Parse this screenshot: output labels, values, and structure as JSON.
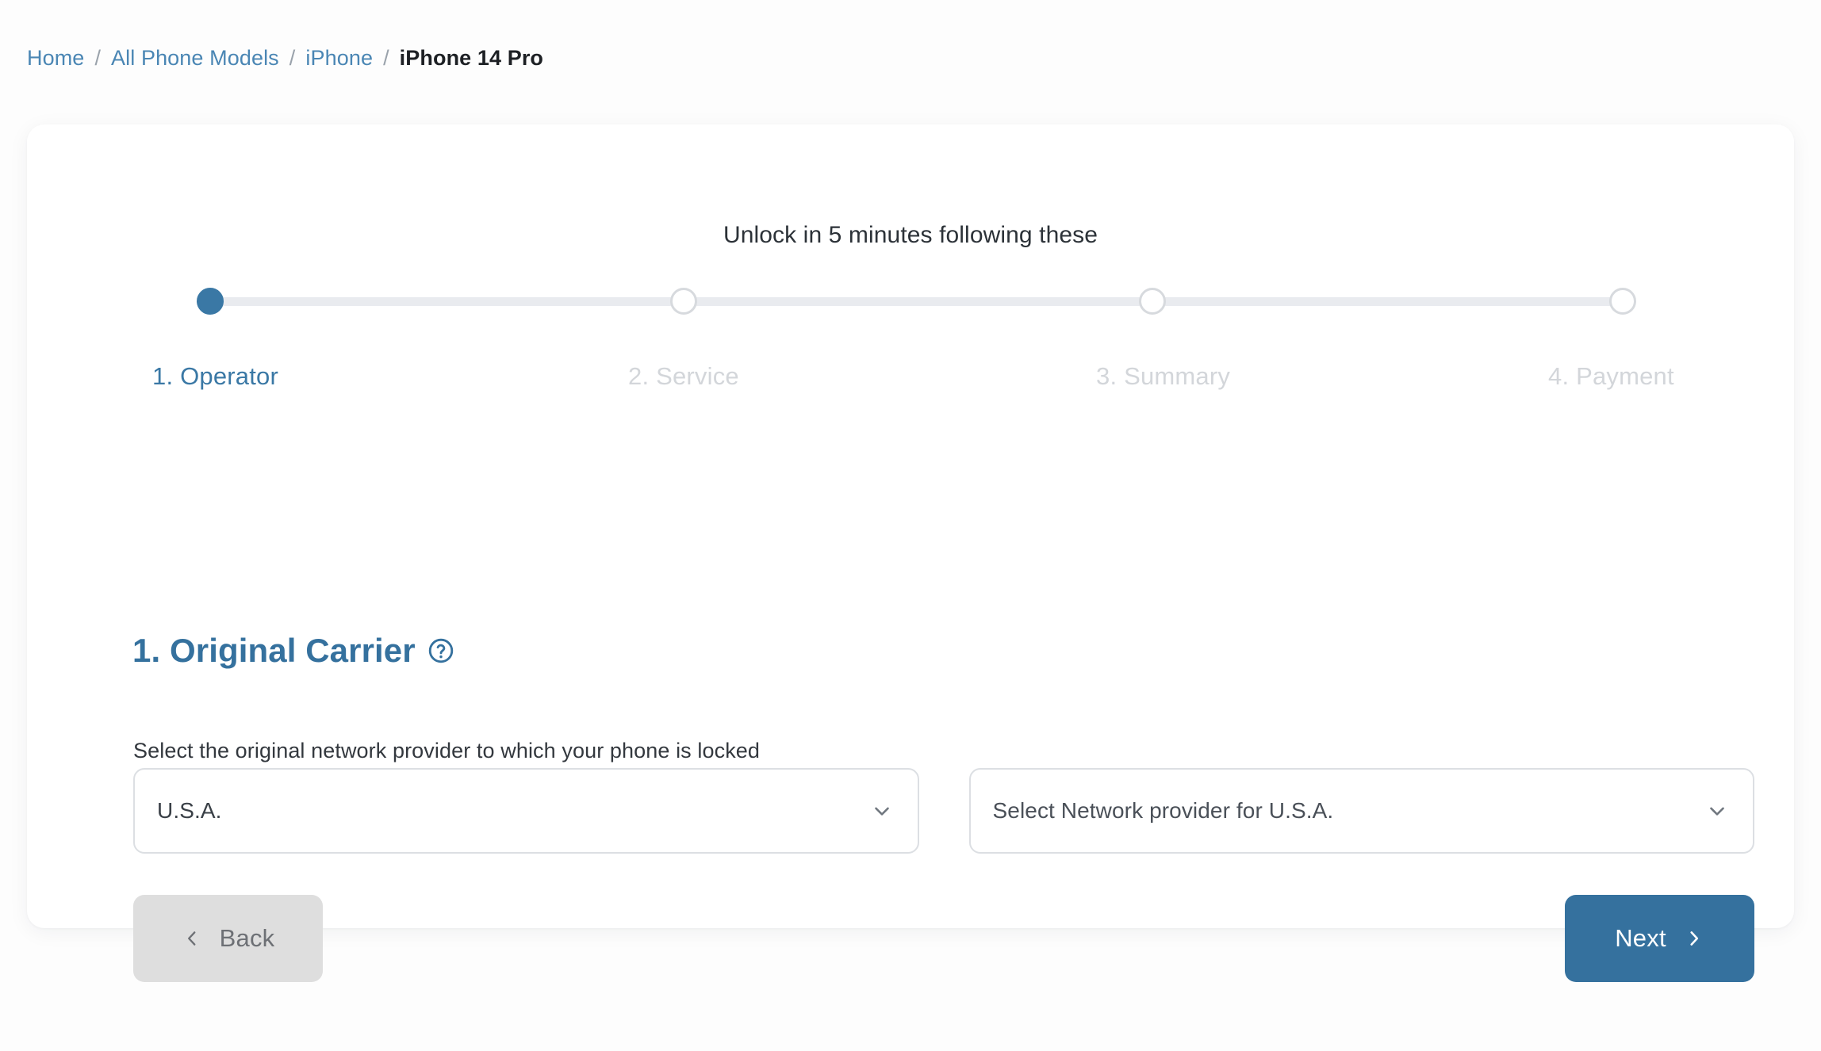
{
  "breadcrumb": {
    "separator": "/",
    "items": [
      {
        "label": "Home",
        "current": false
      },
      {
        "label": "All Phone Models",
        "current": false
      },
      {
        "label": "iPhone",
        "current": false
      },
      {
        "label": "iPhone 14 Pro",
        "current": true
      }
    ]
  },
  "wizard": {
    "title": "Unlock in 5 minutes following these",
    "steps": [
      {
        "label": "1. Operator",
        "state": "active"
      },
      {
        "label": "2. Service",
        "state": "upcoming"
      },
      {
        "label": "3. Summary",
        "state": "upcoming"
      },
      {
        "label": "4. Payment",
        "state": "upcoming"
      }
    ]
  },
  "section": {
    "title": "1. Original Carrier",
    "help_icon": "question-circle-icon",
    "description": "Select the original network provider to which your phone is locked"
  },
  "fields": {
    "country": {
      "value": "U.S.A.",
      "chevron_icon": "chevron-down-icon"
    },
    "network": {
      "placeholder": "Select Network provider for U.S.A.",
      "chevron_icon": "chevron-down-icon"
    }
  },
  "actions": {
    "back": {
      "label": "Back",
      "icon": "chevron-left-icon"
    },
    "next": {
      "label": "Next",
      "icon": "chevron-right-icon"
    }
  },
  "colors": {
    "accent": "#35719e",
    "step_active": "#3a78a5",
    "step_inactive": "#d3d6da",
    "track": "#e9ebef",
    "back_button_bg": "#dedede",
    "link": "#4a86b4"
  }
}
